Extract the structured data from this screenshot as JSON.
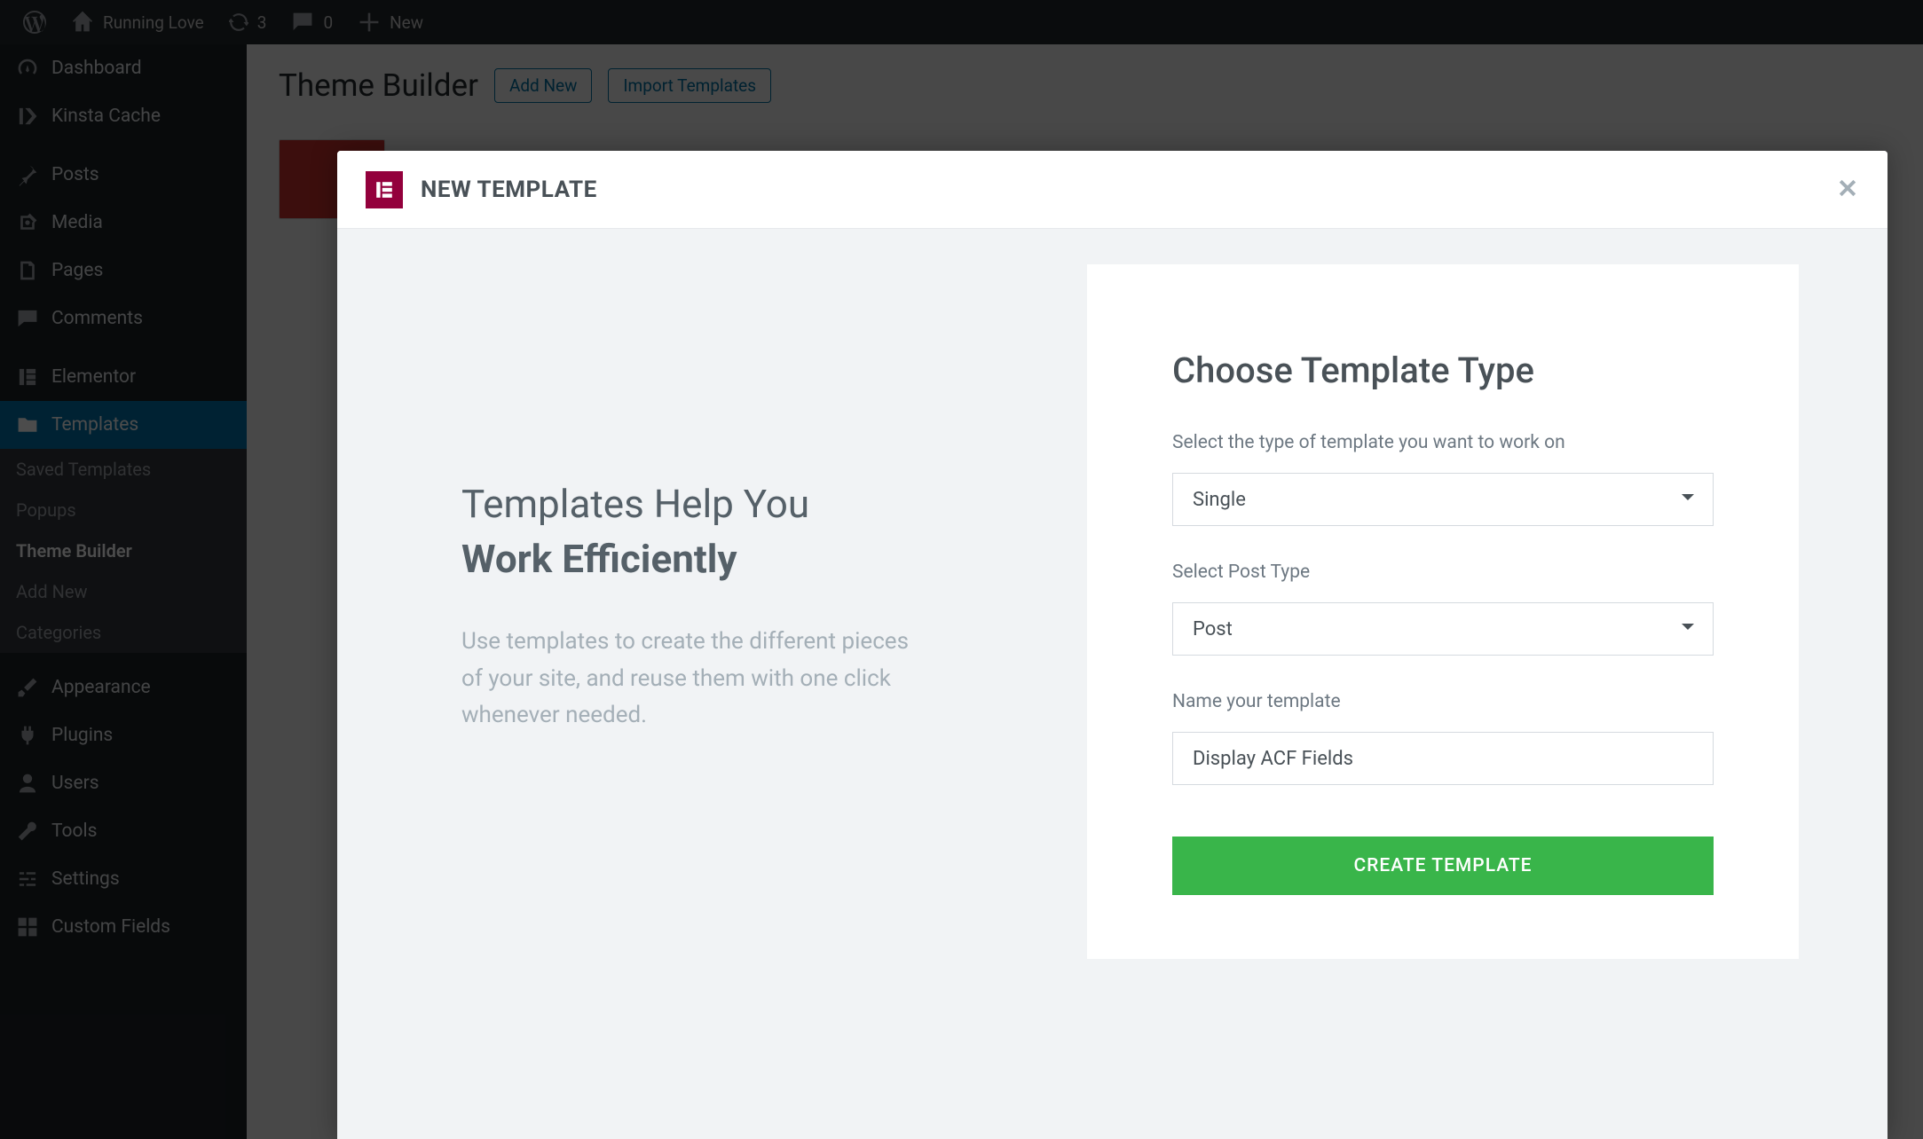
{
  "adminbar": {
    "site_name": "Running Love",
    "updates_count": "3",
    "comments_count": "0",
    "new_label": "New"
  },
  "sidebar": {
    "items": [
      {
        "label": "Dashboard",
        "icon": "dashboard"
      },
      {
        "label": "Kinsta Cache",
        "icon": "kinsta"
      },
      {
        "label": "Posts",
        "icon": "pin"
      },
      {
        "label": "Media",
        "icon": "media"
      },
      {
        "label": "Pages",
        "icon": "page"
      },
      {
        "label": "Comments",
        "icon": "comment"
      },
      {
        "label": "Elementor",
        "icon": "elementor"
      },
      {
        "label": "Templates",
        "icon": "templates"
      },
      {
        "label": "Appearance",
        "icon": "brush"
      },
      {
        "label": "Plugins",
        "icon": "plug"
      },
      {
        "label": "Users",
        "icon": "user"
      },
      {
        "label": "Tools",
        "icon": "wrench"
      },
      {
        "label": "Settings",
        "icon": "sliders"
      },
      {
        "label": "Custom Fields",
        "icon": "grid"
      }
    ],
    "templates_submenu": {
      "items": [
        {
          "label": "Saved Templates"
        },
        {
          "label": "Popups"
        },
        {
          "label": "Theme Builder"
        },
        {
          "label": "Add New"
        },
        {
          "label": "Categories"
        }
      ]
    }
  },
  "page": {
    "title": "Theme Builder",
    "add_new": "Add New",
    "import_templates": "Import Templates"
  },
  "modal": {
    "header_title": "NEW TEMPLATE",
    "left_title_line1": "Templates Help You",
    "left_title_line2": "Work Efficiently",
    "left_desc": "Use templates to create the different pieces of your site, and reuse them with one click whenever needed.",
    "form": {
      "heading": "Choose Template Type",
      "type_label": "Select the type of template you want to work on",
      "type_value": "Single",
      "post_type_label": "Select Post Type",
      "post_type_value": "Post",
      "name_label": "Name your template",
      "name_value": "Display ACF Fields",
      "submit_label": "CREATE TEMPLATE"
    }
  }
}
